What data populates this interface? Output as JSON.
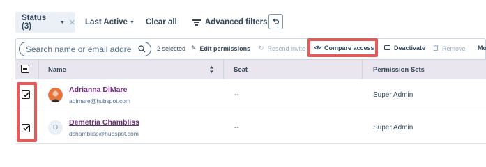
{
  "filters": {
    "status_label": "Status (3)",
    "status_clear_icon": "close-icon",
    "last_active_label": "Last Active",
    "clear_all_label": "Clear all",
    "advanced_filters_label": "Advanced filters",
    "undo_icon": "undo-icon"
  },
  "toolbar": {
    "search_placeholder": "Search name or email address",
    "selected_count": "2 selected",
    "actions": [
      {
        "label": "Edit permissions",
        "icon": "pencil-icon",
        "enabled": true
      },
      {
        "label": "Resend invite",
        "icon": "refresh-icon",
        "enabled": false
      },
      {
        "label": "Compare access",
        "icon": "eye-icon",
        "enabled": true,
        "highlighted": true
      },
      {
        "label": "Deactivate",
        "icon": "card-icon",
        "enabled": true
      },
      {
        "label": "Remove",
        "icon": "trash-icon",
        "enabled": false
      },
      {
        "label": "Mo",
        "icon": "",
        "enabled": true
      }
    ]
  },
  "table": {
    "columns": [
      "Name",
      "Seat",
      "Permission Sets"
    ],
    "rows": [
      {
        "name": "Adrianna DiMare",
        "email": "adimare@hubspot.com",
        "seat": "--",
        "permission_set": "Super Admin",
        "checked": true,
        "avatar": "photo"
      },
      {
        "name": "Demetria Chambliss",
        "email": "dchambliss@hubspot.com",
        "seat": "--",
        "permission_set": "Super Admin",
        "checked": true,
        "avatar": "D"
      }
    ]
  },
  "colors": {
    "highlight": "#e45b5b",
    "header_bg": "#eae6f0",
    "link": "#6b2e7b",
    "text": "#33475b"
  }
}
